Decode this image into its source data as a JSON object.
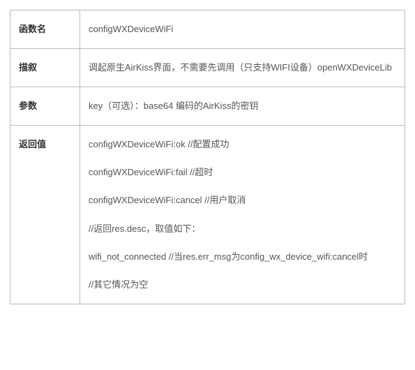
{
  "table": {
    "rows": {
      "funcName": {
        "label": "函数名",
        "value": "configWXDeviceWiFi"
      },
      "description": {
        "label": "描叙",
        "value": "调起原生AirKiss界面，不需要先调用（只支持WIFI设备）openWXDeviceLib"
      },
      "params": {
        "label": "参数",
        "value": "key（可选）：base64 编码的AirKiss的密钥"
      },
      "returnValue": {
        "label": "返回值",
        "lines": {
          "l0": "configWXDeviceWiFi:ok    //配置成功",
          "l1": "configWXDeviceWiFi:fail  //超时",
          "l2": "configWXDeviceWiFi:cancel   //用户取消",
          "l3": "//返回res.desc，取值如下：",
          "l4": "wifi_not_connected //当res.err_msg为config_wx_device_wifi:cancel时",
          "l5": "//其它情况为空"
        }
      }
    }
  }
}
